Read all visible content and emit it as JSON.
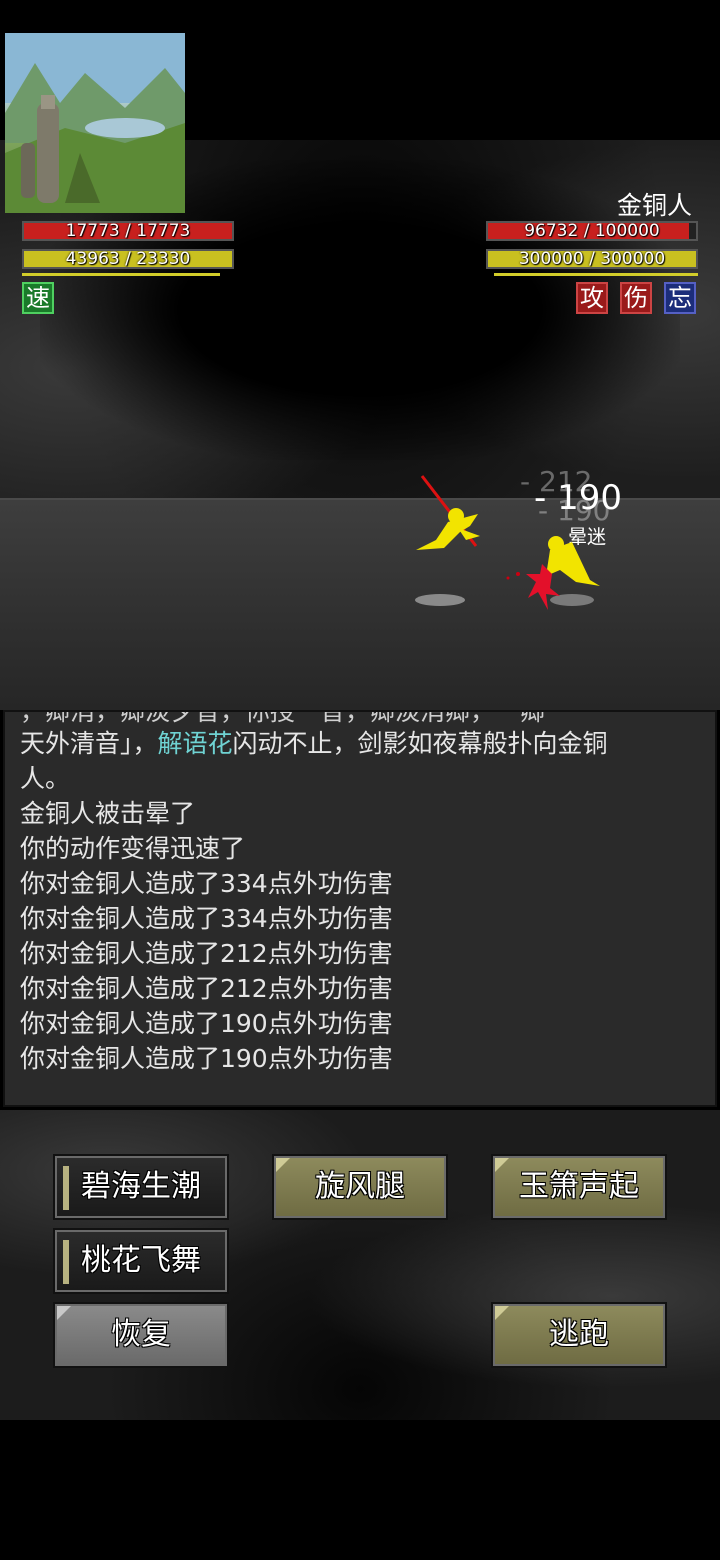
{
  "player": {
    "hp_text": "17773 / 17773",
    "hp_fraction": 1.0,
    "mp_text": "43963 / 23330",
    "mp_fraction": 1.0,
    "buffs": [
      {
        "label": "速",
        "color": "#1a7a2a"
      }
    ]
  },
  "enemy": {
    "name": "金铜人",
    "hp_text": "96732 / 100000",
    "hp_fraction": 0.967,
    "mp_text": "300000 / 300000",
    "mp_fraction": 1.0,
    "debuffs": [
      {
        "label": "攻",
        "color": "#9a1a1a"
      },
      {
        "label": "伤",
        "color": "#9a1a1a"
      },
      {
        "label": "忘",
        "color": "#1c2d7a"
      }
    ]
  },
  "battle": {
    "damage_main": "- 190",
    "damage_ghost_1": "- 212",
    "damage_ghost_2": "- 190",
    "status_text": "晕迷"
  },
  "log": {
    "partial_top": "，卿消，卿淡夕音，你授一音，卿淡消卿，一卿",
    "line1_a": "天外清音」，",
    "line1_name": "解语花",
    "line1_b": "闪动不止，剑影如夜幕般扑向金铜",
    "line2": "人。",
    "lines": [
      "金铜人被击晕了",
      "你的动作变得迅速了",
      "你对金铜人造成了334点外功伤害",
      "你对金铜人造成了334点外功伤害",
      "你对金铜人造成了212点外功伤害",
      "你对金铜人造成了212点外功伤害",
      "你对金铜人造成了190点外功伤害",
      "你对金铜人造成了190点外功伤害"
    ]
  },
  "actions": {
    "skill1": "碧海生潮",
    "skill2": "旋风腿",
    "skill3": "玉箫声起",
    "skill4": "桃花飞舞",
    "recover": "恢复",
    "flee": "逃跑"
  },
  "colors": {
    "hp": "#c8201e",
    "mp": "#c9c020",
    "highlight_name": "#6fd3d3"
  }
}
